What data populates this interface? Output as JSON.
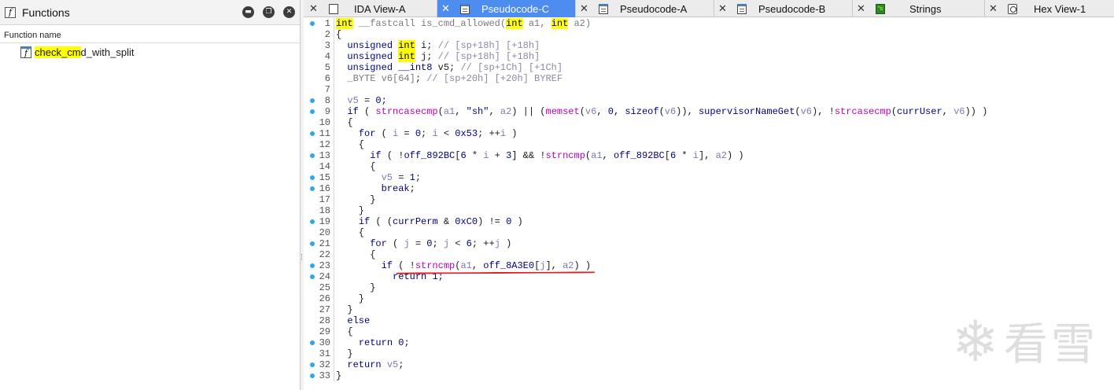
{
  "functions_panel": {
    "title": "Functions",
    "icon": "function-icon",
    "window_buttons": [
      "minimize-icon",
      "restore-icon",
      "close-icon"
    ],
    "column_header": "Function name",
    "items": [
      {
        "name": "check_cmd_with_split",
        "highlight": "check_cm",
        "rest": "d_with_split"
      }
    ]
  },
  "tabs": [
    {
      "label": "IDA View-A",
      "icon": "ida-view-icon",
      "active": false
    },
    {
      "label": "Pseudocode-C",
      "icon": "pseudocode-icon",
      "active": true
    },
    {
      "label": "Pseudocode-A",
      "icon": "pseudocode-icon",
      "active": false
    },
    {
      "label": "Pseudocode-B",
      "icon": "pseudocode-icon",
      "active": false
    },
    {
      "label": "Strings",
      "icon": "strings-icon",
      "active": false
    },
    {
      "label": "Hex View-1",
      "icon": "hex-view-icon",
      "active": false
    }
  ],
  "code": {
    "line_numbers": [
      "1",
      "2",
      "3",
      "4",
      "5",
      "6",
      "7",
      "8",
      "9",
      "10",
      "11",
      "12",
      "13",
      "14",
      "15",
      "16",
      "17",
      "18",
      "19",
      "20",
      "21",
      "22",
      "23",
      "24",
      "25",
      "26",
      "27",
      "28",
      "29",
      "30",
      "31",
      "32",
      "33"
    ],
    "breakpoint_lines": [
      1,
      8,
      9,
      11,
      13,
      15,
      16,
      19,
      21,
      23,
      24,
      30,
      32,
      33
    ],
    "colors": {
      "keyword": "#000080",
      "comment": "#8a8aa8",
      "variable": "#7b7bb0",
      "function": "#bb00bb",
      "highlight": "#ffff00",
      "underline": "#e02020",
      "active_tab": "#4d8df0",
      "dot": "#2fa6e6"
    }
  },
  "watermark": {
    "icon": "snowflake-icon",
    "text": "看雪"
  }
}
